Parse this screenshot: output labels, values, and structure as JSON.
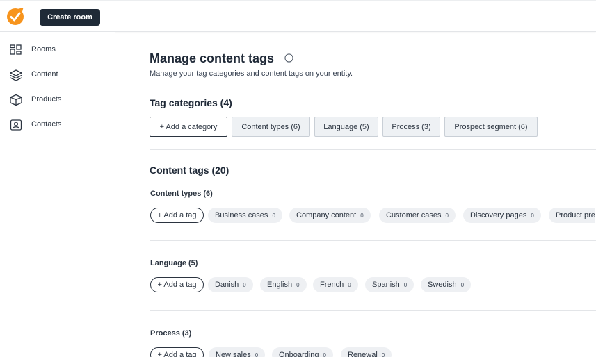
{
  "header": {
    "create_room_label": "Create room"
  },
  "sidebar": {
    "items": [
      {
        "label": "Rooms",
        "icon": "grid-icon"
      },
      {
        "label": "Content",
        "icon": "layers-icon"
      },
      {
        "label": "Products",
        "icon": "box-icon"
      },
      {
        "label": "Contacts",
        "icon": "contact-card-icon"
      }
    ]
  },
  "main": {
    "title": "Manage content tags",
    "subtitle": "Manage your tag categories and content tags on your entity.",
    "categories": {
      "heading": "Tag categories (4)",
      "add_label": "+ Add a category",
      "items": [
        "Content types (6)",
        "Language (5)",
        "Process (3)",
        "Prospect segment (6)"
      ]
    },
    "content_tags": {
      "heading": "Content tags (20)",
      "add_tag_label": "+ Add a tag",
      "groups": [
        {
          "title": "Content types (6)",
          "tags": [
            {
              "name": "Business cases",
              "count": "0"
            },
            {
              "name": "Company content",
              "count": "0"
            },
            {
              "name": "Customer cases",
              "count": "0"
            },
            {
              "name": "Discovery pages",
              "count": "0"
            },
            {
              "name": "Product pre",
              "count": ""
            }
          ]
        },
        {
          "title": "Language (5)",
          "tags": [
            {
              "name": "Danish",
              "count": "0"
            },
            {
              "name": "English",
              "count": "0"
            },
            {
              "name": "French",
              "count": "0"
            },
            {
              "name": "Spanish",
              "count": "0"
            },
            {
              "name": "Swedish",
              "count": "0"
            }
          ]
        },
        {
          "title": "Process (3)",
          "tags": [
            {
              "name": "New sales",
              "count": "0"
            },
            {
              "name": "Onboarding",
              "count": "0"
            },
            {
              "name": "Renewal",
              "count": "0"
            }
          ]
        }
      ]
    }
  },
  "colors": {
    "brand": "#f7941d",
    "dark": "#1f2a37",
    "tag_bg": "#eef0f3"
  }
}
